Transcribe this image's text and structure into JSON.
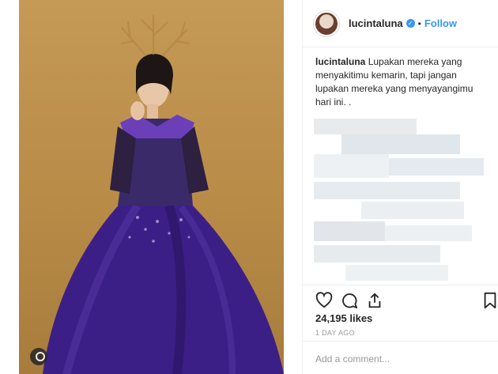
{
  "post": {
    "username": "lucintaluna",
    "verified_icon": "verified-badge-icon",
    "separator": "•",
    "follow_label": "Follow",
    "caption_user": "lucintaluna",
    "caption_text": "Lupakan mereka yang menyakitimu kemarin, tapi jangan lupakan mereka yang menyayangimu hari ini. .",
    "likes": "24,195 likes",
    "time": "1 DAY AGO",
    "comment_placeholder": "Add a comment..."
  },
  "colors": {
    "accent": "#3897f0",
    "text": "#262626",
    "muted": "#999999",
    "gown": "#3c1f86",
    "backdrop": "#c49a56"
  },
  "icons": [
    "heart-icon",
    "comment-icon",
    "share-icon",
    "bookmark-icon",
    "instagram-mark-icon"
  ]
}
